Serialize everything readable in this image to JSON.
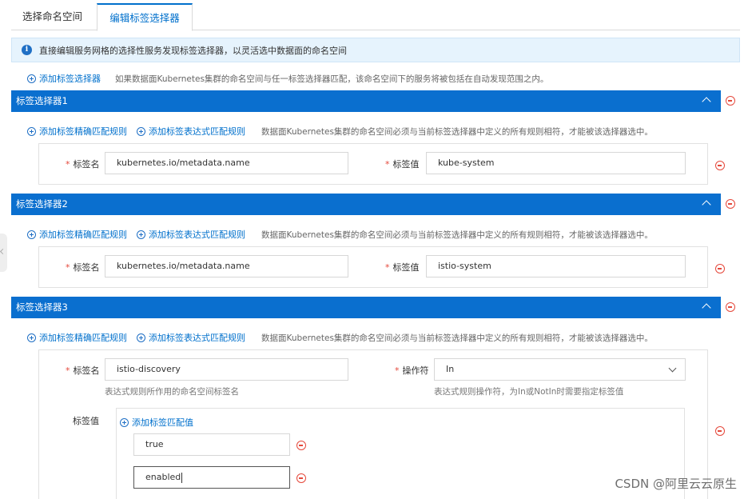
{
  "tabs": [
    {
      "label": "选择命名空间",
      "active": false
    },
    {
      "label": "编辑标签选择器",
      "active": true
    }
  ],
  "info": {
    "icon": "info-icon",
    "text": "直接编辑服务网格的选择性服务发现标签选择器，以灵活选中数据面的命名空间"
  },
  "add_selector": {
    "label": "添加标签选择器",
    "hint": "如果数据面Kubernetes集群的命名空间与任一标签选择器匹配，该命名空间下的服务将被包括在自动发现范围之内。"
  },
  "rule_actions": {
    "exact_label": "添加标签精确匹配规则",
    "expr_label": "添加标签表达式匹配规则",
    "hint": "数据面Kubernetes集群的命名空间必须与当前标签选择器中定义的所有规则相符，才能被该选择器选中。"
  },
  "selectors": [
    {
      "title": "标签选择器1",
      "key_label": "标签名",
      "key_value": "kubernetes.io/metadata.name",
      "val_label": "标签值",
      "val_value": "kube-system"
    },
    {
      "title": "标签选择器2",
      "key_label": "标签名",
      "key_value": "kubernetes.io/metadata.name",
      "val_label": "标签值",
      "val_value": "istio-system"
    },
    {
      "title": "标签选择器3",
      "key_label": "标签名",
      "key_value": "istio-discovery",
      "key_help": "表达式规则所作用的命名空间标签名",
      "op_label": "操作符",
      "op_value": "In",
      "op_help": "表达式规则操作符，为In或NotIn时需要指定标签值",
      "values_label": "标签值",
      "add_value_label": "添加标签匹配值",
      "values": [
        "true",
        "enabled"
      ]
    }
  ],
  "watermark": "CSDN @阿里云云原生",
  "colors": {
    "primary": "#0a6fcf",
    "link": "#0070cc",
    "danger": "#e5483b",
    "info_bg": "#e6f3fd"
  }
}
